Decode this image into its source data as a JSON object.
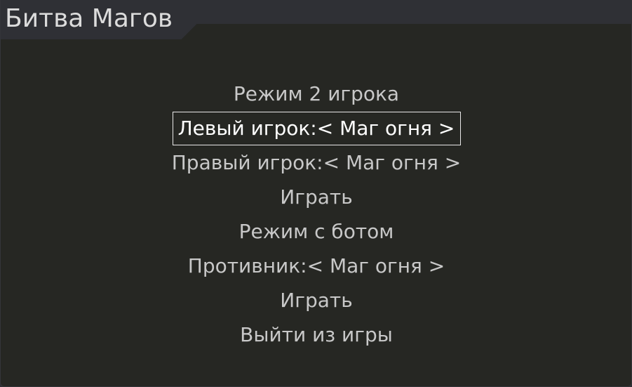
{
  "window": {
    "title": "Битва Магов"
  },
  "menu": {
    "items": [
      {
        "label": "Режим 2 игрока"
      },
      {
        "label": "Левый игрок:< Маг огня >"
      },
      {
        "label": "Правый игрок:< Маг огня >"
      },
      {
        "label": "Играть"
      },
      {
        "label": "Режим с ботом"
      },
      {
        "label": "Противник:< Маг огня >"
      },
      {
        "label": "Играть"
      },
      {
        "label": "Выйти из игры"
      }
    ],
    "selected_index": 1
  },
  "colors": {
    "background": "#262723",
    "titlebar": "#2f3035",
    "text": "#c8c8c8",
    "selected_text": "#ffffff",
    "selected_border": "#e8e8e8"
  }
}
